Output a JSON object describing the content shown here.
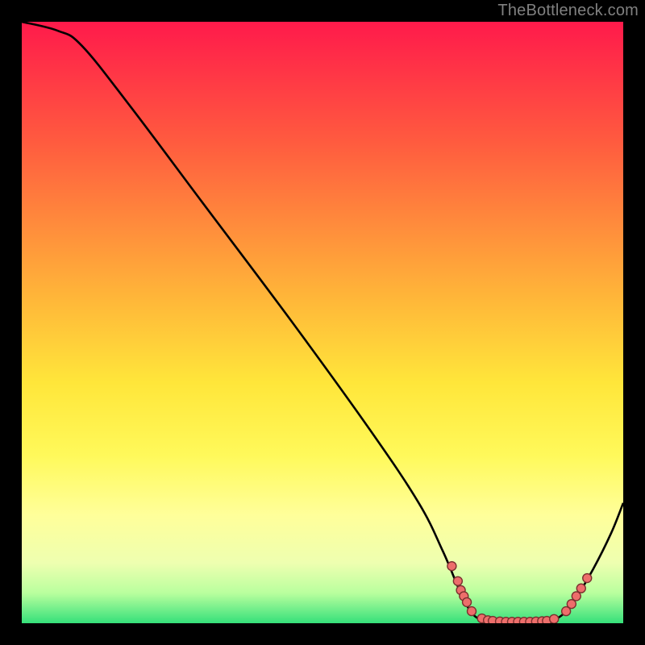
{
  "attribution": "TheBottleneck.com",
  "colors": {
    "curve": "#000000",
    "marker_fill": "#ed6e6b",
    "marker_stroke": "#7a2f2e",
    "frame_bg": "#000000"
  },
  "chart_data": {
    "type": "line",
    "title": "",
    "xlabel": "",
    "ylabel": "",
    "xlim": [
      0,
      100
    ],
    "ylim": [
      0,
      100
    ],
    "grid": false,
    "gradient_stops": [
      {
        "pct": 0,
        "color": "#ff1a4b"
      },
      {
        "pct": 20,
        "color": "#ff5b3f"
      },
      {
        "pct": 45,
        "color": "#ffb339"
      },
      {
        "pct": 60,
        "color": "#ffe63a"
      },
      {
        "pct": 72,
        "color": "#fff95a"
      },
      {
        "pct": 82,
        "color": "#ffff9a"
      },
      {
        "pct": 90,
        "color": "#eeffb0"
      },
      {
        "pct": 95,
        "color": "#b9ff9e"
      },
      {
        "pct": 100,
        "color": "#35e07a"
      }
    ],
    "curve": [
      {
        "x": 0,
        "y": 100
      },
      {
        "x": 6,
        "y": 98.5
      },
      {
        "x": 10,
        "y": 96
      },
      {
        "x": 18,
        "y": 86
      },
      {
        "x": 30,
        "y": 70
      },
      {
        "x": 45,
        "y": 50
      },
      {
        "x": 58,
        "y": 32
      },
      {
        "x": 66,
        "y": 20
      },
      {
        "x": 70,
        "y": 12
      },
      {
        "x": 73,
        "y": 5
      },
      {
        "x": 75,
        "y": 1.5
      },
      {
        "x": 77,
        "y": 0.5
      },
      {
        "x": 80,
        "y": 0.2
      },
      {
        "x": 85,
        "y": 0.2
      },
      {
        "x": 88,
        "y": 0.5
      },
      {
        "x": 90,
        "y": 1.5
      },
      {
        "x": 92,
        "y": 4
      },
      {
        "x": 95,
        "y": 9
      },
      {
        "x": 98,
        "y": 15
      },
      {
        "x": 100,
        "y": 20
      }
    ],
    "markers": [
      {
        "x": 71.5,
        "y": 9.5
      },
      {
        "x": 72.5,
        "y": 7.0
      },
      {
        "x": 73.0,
        "y": 5.5
      },
      {
        "x": 73.5,
        "y": 4.5
      },
      {
        "x": 74.0,
        "y": 3.5
      },
      {
        "x": 74.8,
        "y": 2.0
      },
      {
        "x": 76.5,
        "y": 0.8
      },
      {
        "x": 77.5,
        "y": 0.5
      },
      {
        "x": 78.3,
        "y": 0.4
      },
      {
        "x": 79.5,
        "y": 0.3
      },
      {
        "x": 80.5,
        "y": 0.25
      },
      {
        "x": 81.5,
        "y": 0.25
      },
      {
        "x": 82.5,
        "y": 0.25
      },
      {
        "x": 83.5,
        "y": 0.25
      },
      {
        "x": 84.5,
        "y": 0.25
      },
      {
        "x": 85.5,
        "y": 0.3
      },
      {
        "x": 86.5,
        "y": 0.35
      },
      {
        "x": 87.3,
        "y": 0.4
      },
      {
        "x": 88.5,
        "y": 0.7
      },
      {
        "x": 90.5,
        "y": 2.0
      },
      {
        "x": 91.4,
        "y": 3.2
      },
      {
        "x": 92.2,
        "y": 4.5
      },
      {
        "x": 93.0,
        "y": 5.8
      },
      {
        "x": 94.0,
        "y": 7.5
      }
    ],
    "marker_radius": 5.5
  }
}
